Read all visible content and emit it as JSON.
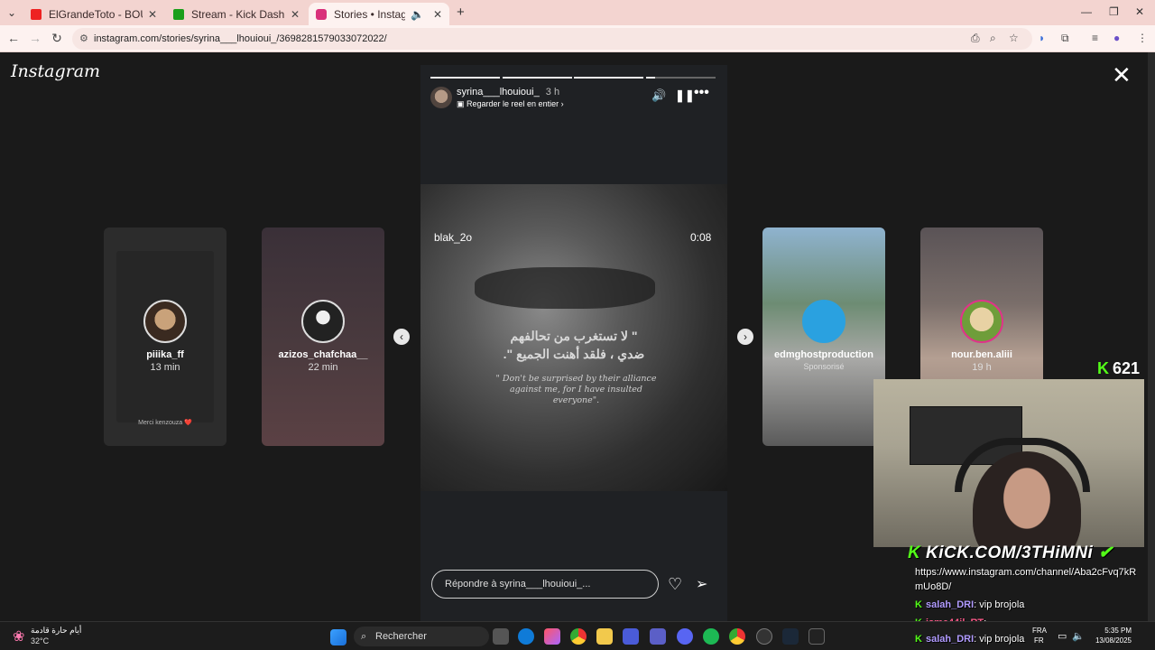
{
  "browser": {
    "tabs": [
      {
        "title": "ElGrandeToto - BOUHALI (كلمات)",
        "favicon_color": "#e22"
      },
      {
        "title": "Stream - Kick Dashboard",
        "favicon_color": "#1a9e1a"
      },
      {
        "title": "Stories • Instagram",
        "favicon_color": "#d9317a"
      }
    ],
    "new_tab_label": "+",
    "url": "instagram.com/stories/syrina___lhouioui_/3698281579033072022/"
  },
  "instagram": {
    "logo": "Instagram",
    "close_label": "✕",
    "left_stories": [
      {
        "name": "piiika_ff",
        "time": "13 min",
        "footer": "Merci kenzouza ❤️"
      },
      {
        "name": "azizos_chafchaa__",
        "time": "22 min"
      }
    ],
    "right_stories": [
      {
        "name": "edmghostproduction",
        "time": "Sponsorisé"
      },
      {
        "name": "nour.ben.aliii",
        "time": "19 h"
      }
    ],
    "current_story": {
      "username": "syrina___lhouioui_",
      "time": "3 h",
      "subtitle": "Regarder le reel en entier",
      "progress": [
        1,
        1,
        1,
        0.1
      ],
      "media_username": "blak_2o",
      "media_time": "0:08",
      "quote_arabic_line1": "\" لا تستغرب من تحالفهم",
      "quote_arabic_line2": "ضدي ، فلقد أهنت الجميع \".",
      "quote_english": "\" Don't be surprised by their alliance against me, for I have insulted everyone\".",
      "reply_placeholder": "Répondre à syrina___lhouioui_..."
    }
  },
  "stream": {
    "viewer_count": "621",
    "banner": "KiCK.COM/3THiMNi",
    "chat": [
      {
        "user": "",
        "message": "https://www.instagram.com/channel/Aba2cFvq7kR"
      },
      {
        "user": "",
        "message": "mUo8D/"
      },
      {
        "user": "salah_DRI",
        "message": ": vip brojola"
      },
      {
        "user": "isme44il_RT",
        "message": ":"
      },
      {
        "user": "salah_DRI",
        "message": ": vip brojola"
      }
    ]
  },
  "taskbar": {
    "weather_text": "أيام حارة قادمة",
    "temperature": "32°C",
    "search_label": "Rechercher",
    "lang": "FRA",
    "lang_sub": "FR",
    "time": "5:35 PM",
    "date": "13/08/2025"
  }
}
